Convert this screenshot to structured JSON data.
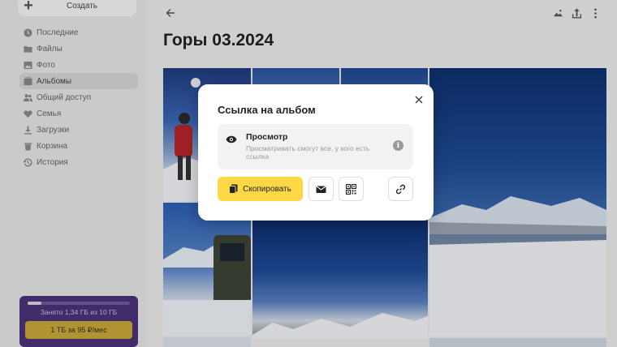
{
  "sidebar": {
    "create_label": "Создать",
    "items": [
      {
        "label": "Последние",
        "icon": "clock-icon",
        "active": false
      },
      {
        "label": "Файлы",
        "icon": "folder-icon",
        "active": false
      },
      {
        "label": "Фото",
        "icon": "image-icon",
        "active": false
      },
      {
        "label": "Альбомы",
        "icon": "albums-icon",
        "active": true
      },
      {
        "label": "Общий доступ",
        "icon": "people-icon",
        "active": false
      },
      {
        "label": "Семья",
        "icon": "family-icon",
        "active": false
      },
      {
        "label": "Загрузки",
        "icon": "download-icon",
        "active": false
      },
      {
        "label": "Корзина",
        "icon": "trash-icon",
        "active": false
      },
      {
        "label": "История",
        "icon": "history-icon",
        "active": false
      }
    ],
    "storage": {
      "used_text": "Занято 1,34 ГБ из 10 ГБ",
      "used_fraction": 0.134,
      "upgrade_label": "1 ТБ за 95 ₽/мес"
    }
  },
  "header": {
    "title": "Горы 03.2024"
  },
  "modal": {
    "title": "Ссылка на альбом",
    "permission": {
      "title": "Просмотр",
      "description": "Просматривать смогут все, у кого есть ссылка"
    },
    "copy_label": "Скопировать",
    "info_glyph": "i"
  },
  "colors": {
    "accent": "#fcd846",
    "storage_bg": "#4a3378"
  }
}
